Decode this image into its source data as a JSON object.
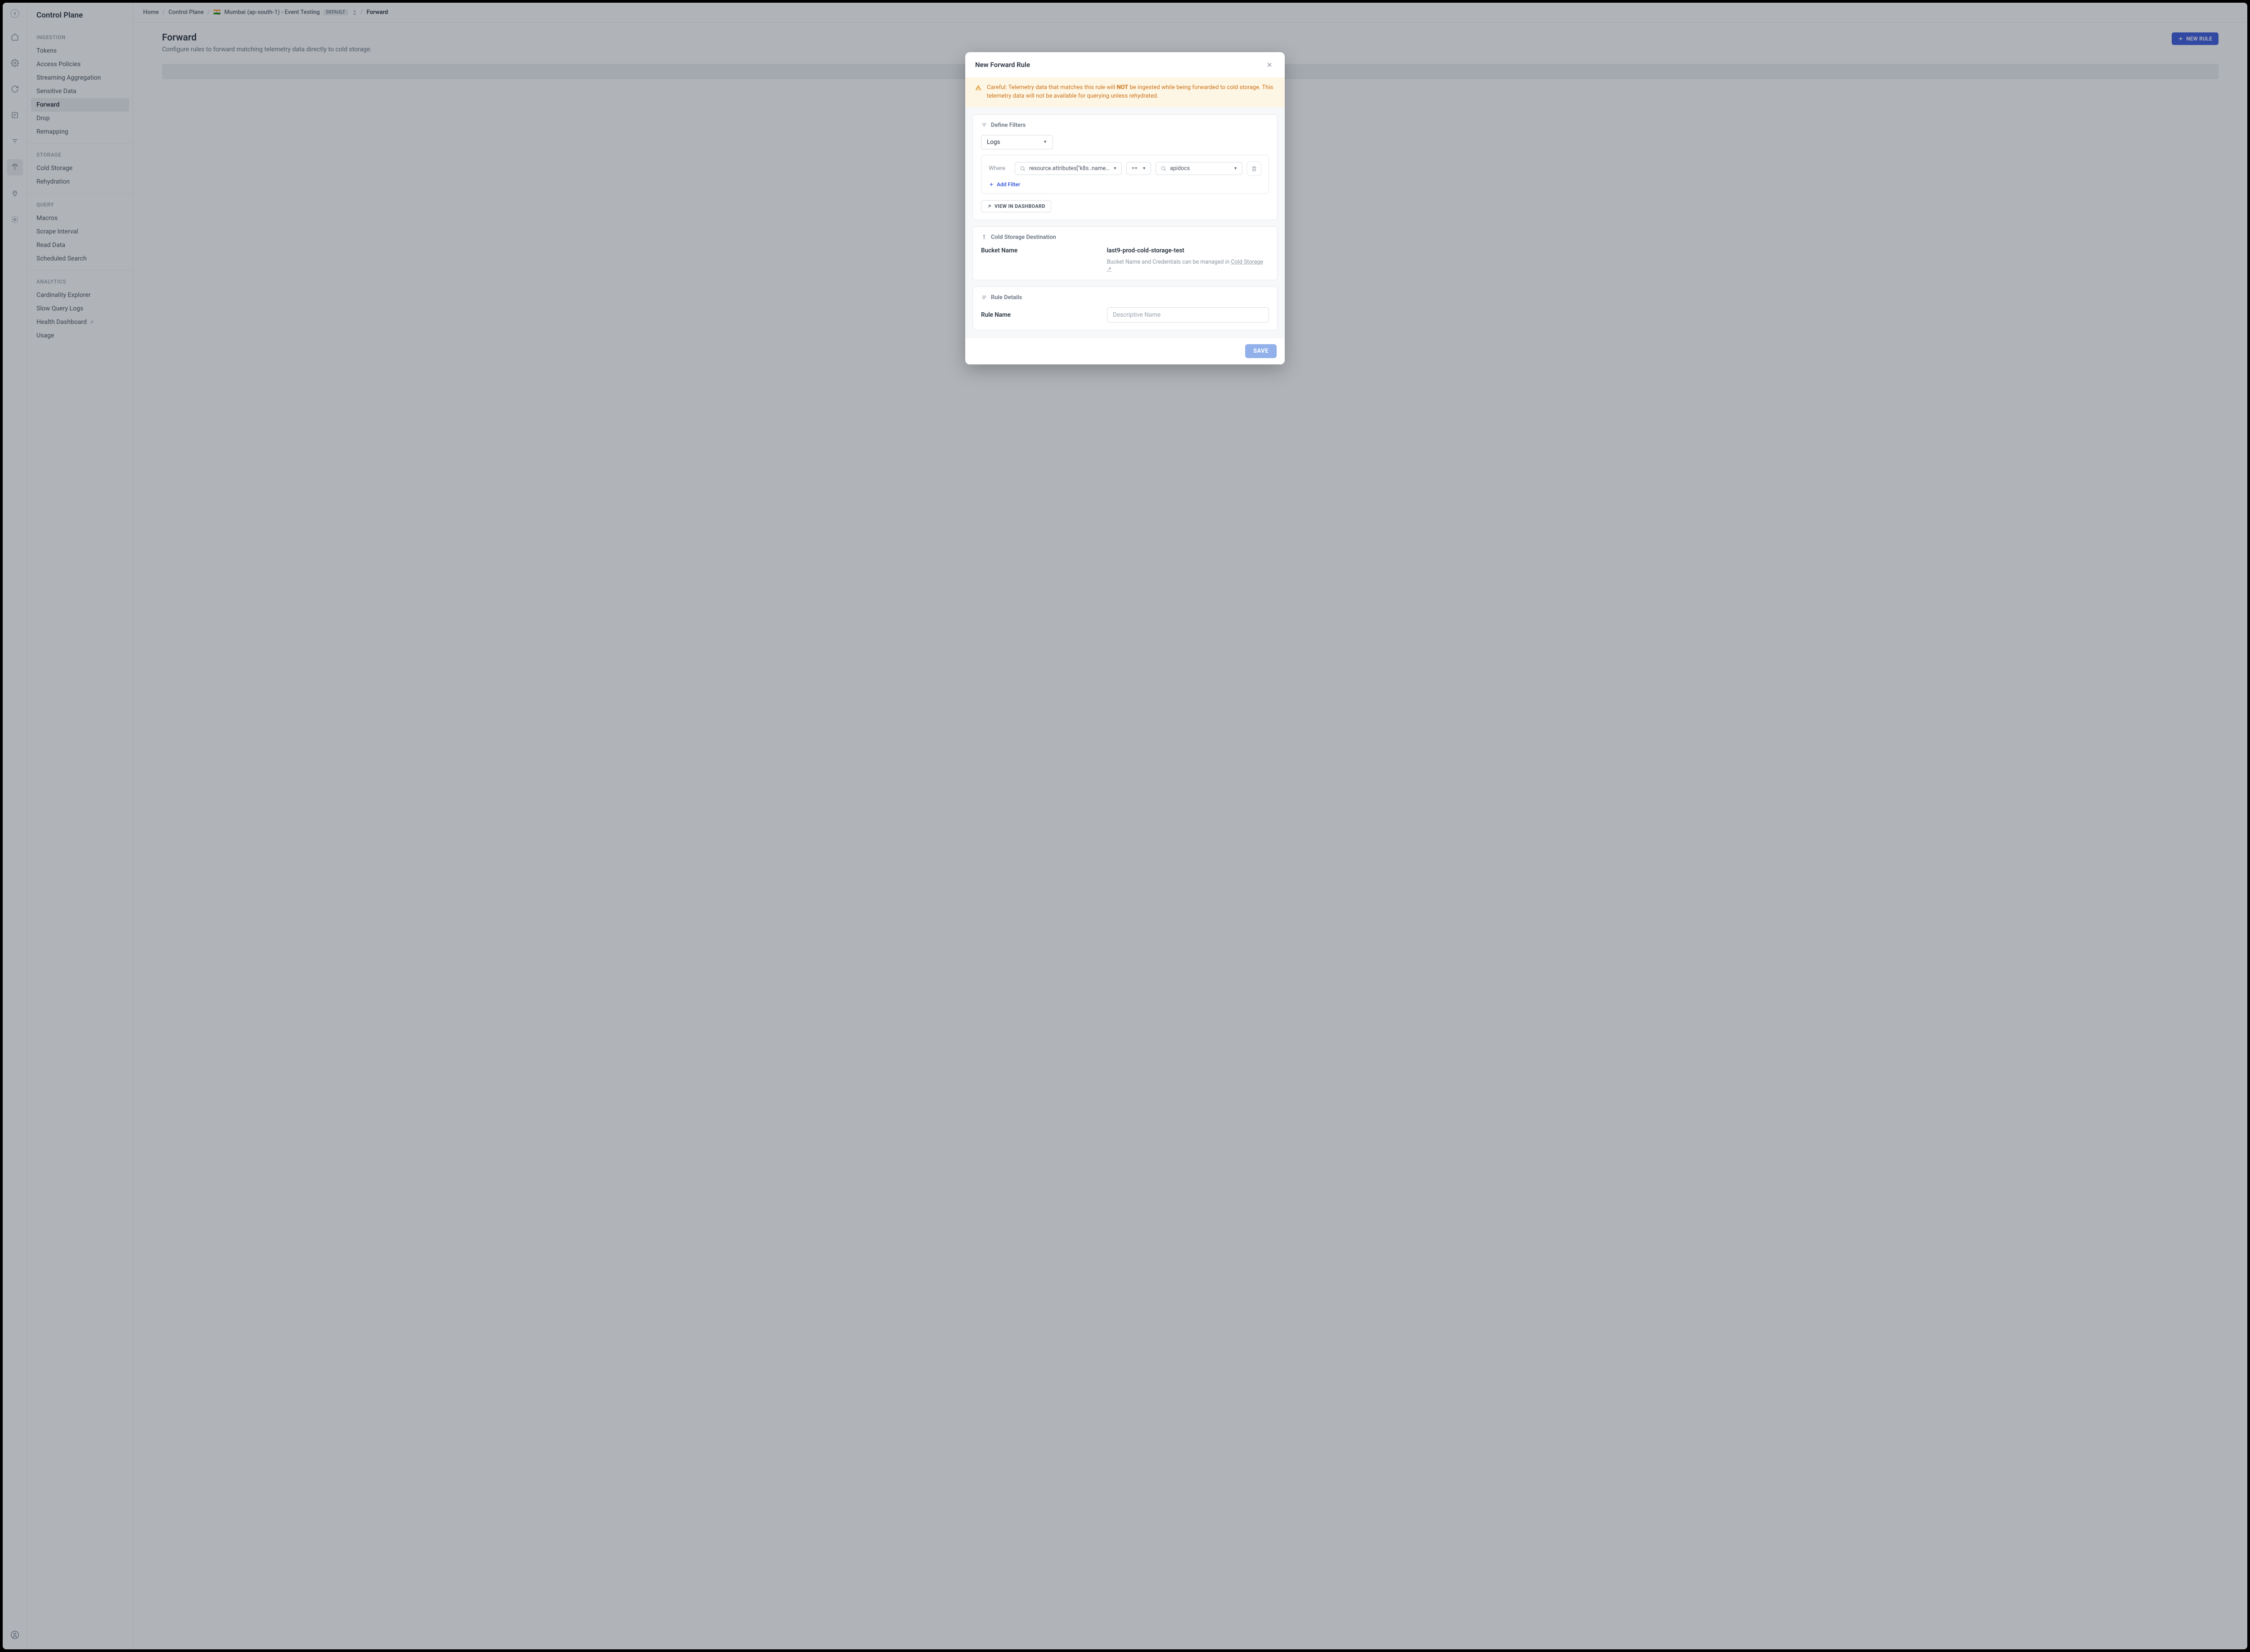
{
  "sidebar": {
    "title": "Control Plane",
    "groups": [
      {
        "title": "INGESTION",
        "items": [
          {
            "label": "Tokens"
          },
          {
            "label": "Access Policies"
          },
          {
            "label": "Streaming Aggregation"
          },
          {
            "label": "Sensitive Data"
          },
          {
            "label": "Forward",
            "active": true
          },
          {
            "label": "Drop"
          },
          {
            "label": "Remapping"
          }
        ]
      },
      {
        "title": "STORAGE",
        "items": [
          {
            "label": "Cold Storage"
          },
          {
            "label": "Rehydration"
          }
        ]
      },
      {
        "title": "QUERY",
        "items": [
          {
            "label": "Macros"
          },
          {
            "label": "Scrape Interval"
          },
          {
            "label": "Read Data"
          },
          {
            "label": "Scheduled Search"
          }
        ]
      },
      {
        "title": "ANALYTICS",
        "items": [
          {
            "label": "Cardinality Explorer"
          },
          {
            "label": "Slow Query Logs"
          },
          {
            "label": "Health Dashboard",
            "external": true
          },
          {
            "label": "Usage"
          }
        ]
      }
    ]
  },
  "breadcrumbs": {
    "home": "Home",
    "section": "Control Plane",
    "flag": "🇮🇳",
    "env": "Mumbai (ap-south-1) - Event Testing",
    "badge": "DEFAULT",
    "page": "Forward"
  },
  "page": {
    "title": "Forward",
    "subtitle": "Configure rules to forward matching telemetry data directly to cold storage.",
    "new_rule_label": "NEW RULE"
  },
  "modal": {
    "title": "New Forward Rule",
    "warning_prefix": "Careful: Telemetry data that matches this rule will ",
    "warning_bold": "NOT",
    "warning_suffix": " be ingested while being forwarded to cold storage. This telemetry data will not be available for querying unless rehydrated.",
    "filters_section": "Define Filters",
    "data_type": "Logs",
    "where_label": "Where",
    "attr_value": "resource.attributes[\"k8s..name…",
    "op_value": "==",
    "val_value": "apidocs",
    "add_filter": "Add Filter",
    "view_dashboard": "VIEW IN DASHBOARD",
    "dest_section": "Cold Storage Destination",
    "bucket_label": "Bucket Name",
    "bucket_value": "last9-prod-cold-storage-test",
    "bucket_hint_prefix": "Bucket Name and Credentials can be managed in ",
    "bucket_hint_link": "Cold Storage",
    "details_section": "Rule Details",
    "rule_name_label": "Rule Name",
    "rule_name_placeholder": "Descriptive Name",
    "save_label": "SAVE"
  }
}
